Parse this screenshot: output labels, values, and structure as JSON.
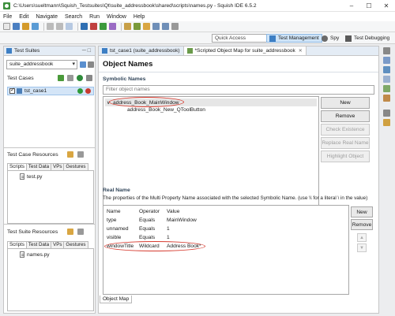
{
  "window": {
    "title": "C:\\Users\\sueltmann\\Squish_Testsuites\\Qt\\suite_addressbook\\shared\\scripts\\names.py - Squish IDE 6.5.2"
  },
  "menu": [
    "File",
    "Edit",
    "Navigate",
    "Search",
    "Run",
    "Window",
    "Help"
  ],
  "toolbar": {
    "quick_access": "Quick Access"
  },
  "perspectives": [
    {
      "label": "Test Management",
      "active": true
    },
    {
      "label": "Spy",
      "active": false
    },
    {
      "label": "Test Debugging",
      "active": false
    }
  ],
  "left": {
    "test_suites": {
      "tab": "Test Suites",
      "selected_suite": "suite_addressbook"
    },
    "test_cases": {
      "label": "Test Cases",
      "items": [
        "tst_case1"
      ]
    },
    "test_case_resources": {
      "label": "Test Case Resources",
      "tabs": [
        "Scripts",
        "Test Data",
        "VPs",
        "Gestures"
      ],
      "files": [
        "test.py"
      ]
    },
    "test_suite_resources": {
      "label": "Test Suite Resources",
      "tabs": [
        "Scripts",
        "Test Data",
        "VPs",
        "Gestures"
      ],
      "files": [
        "names.py"
      ]
    }
  },
  "editor": {
    "tabs": [
      {
        "label": "tst_case1 (suite_addressbook)"
      },
      {
        "label": "*Scripted Object Map for suite_addressbook"
      }
    ],
    "heading": "Object Names",
    "symbolic": {
      "title": "Symbolic Names",
      "filter_placeholder": "Filter object names",
      "tree": [
        {
          "name": "address_Book_MainWindow",
          "expanded": true
        },
        {
          "name": "address_Book_New_QToolButton"
        }
      ],
      "buttons": {
        "new": "New",
        "remove": "Remove",
        "check": "Check Existence",
        "replace": "Replace Real Name",
        "highlight": "Highlight Object"
      }
    },
    "real_name": {
      "title": "Real Name",
      "description": "The properties of the Multi Property Name associated with the selected Symbolic Name. (use \\\\ for a literal \\ in the value)",
      "columns": [
        "Name",
        "Operator",
        "Value"
      ],
      "rows": [
        [
          "type",
          "Equals",
          "MainWindow"
        ],
        [
          "unnamed",
          "Equals",
          "1"
        ],
        [
          "visible",
          "Equals",
          "1"
        ],
        [
          "windowTitle",
          "Wildcard",
          "Address Book*"
        ]
      ],
      "buttons": {
        "new": "New",
        "remove": "Remove"
      }
    },
    "bottom_tab": "Object Map"
  }
}
